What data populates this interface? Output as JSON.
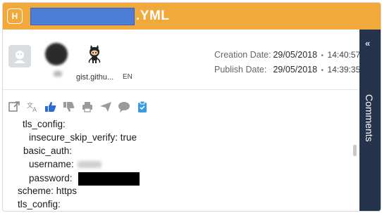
{
  "header": {
    "badge": "H",
    "title_suffix": ".YML",
    "colors": {
      "bar": "#f2a93b",
      "redaction": "#4d7ed6"
    }
  },
  "meta": {
    "source_label": "gist.githu...",
    "language": "EN",
    "creation_label": "Creation Date:",
    "creation_date": "29/05/2018",
    "creation_time": "14:40:57",
    "publish_label": "Publish Date:",
    "publish_date": "29/05/2018",
    "publish_time": "14:39:35",
    "separator": "•"
  },
  "toolbar": {
    "icons": [
      "open-external-icon",
      "translate-icon",
      "thumbs-up-icon",
      "thumbs-down-icon",
      "print-icon",
      "send-icon",
      "comment-icon",
      "clipboard-icon"
    ]
  },
  "code": {
    "lines": [
      "tls_config:",
      "insecure_skip_verify: true",
      "basic_auth:",
      "username:",
      "password:",
      "scheme: https",
      "tls_config:"
    ]
  },
  "side_panel": {
    "chevron": "«",
    "label": "Comments",
    "color": "#25344c"
  }
}
